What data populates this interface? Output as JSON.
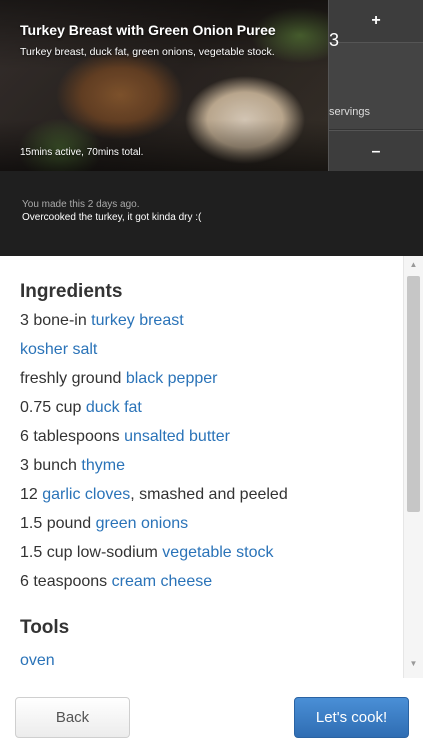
{
  "recipe": {
    "title": "Turkey Breast with Green Onion Puree",
    "subtitle": "Turkey breast, duck fat, green onions, vegetable stock.",
    "time": "15mins active, 70mins total."
  },
  "servings": {
    "plus": "+",
    "count": "3",
    "label": "servings",
    "minus": "–"
  },
  "history": {
    "made_when": "You made this 2 days ago.",
    "note": "Overcooked the turkey, it got kinda dry :("
  },
  "ingredients": {
    "heading": "Ingredients",
    "items": [
      {
        "prefix": "3 bone-in ",
        "link": "turkey breast",
        "suffix": ""
      },
      {
        "prefix": "",
        "link": "kosher salt",
        "suffix": ""
      },
      {
        "prefix": "freshly ground ",
        "link": "black pepper",
        "suffix": ""
      },
      {
        "prefix": "0.75 cup ",
        "link": "duck fat",
        "suffix": ""
      },
      {
        "prefix": "6 tablespoons ",
        "link": "unsalted butter",
        "suffix": ""
      },
      {
        "prefix": "3 bunch ",
        "link": "thyme",
        "suffix": ""
      },
      {
        "prefix": "12 ",
        "link": "garlic cloves",
        "suffix": ", smashed and peeled"
      },
      {
        "prefix": "1.5 pound ",
        "link": "green onions",
        "suffix": ""
      },
      {
        "prefix": "1.5 cup low-sodium ",
        "link": "vegetable stock",
        "suffix": ""
      },
      {
        "prefix": "6 teaspoons ",
        "link": "cream cheese",
        "suffix": ""
      }
    ]
  },
  "tools": {
    "heading": "Tools",
    "items": [
      "oven"
    ]
  },
  "scrollbar": {
    "up_icon": "▲",
    "down_icon": "▼"
  },
  "footer": {
    "back_label": "Back",
    "cook_label": "Let's cook!"
  },
  "colors": {
    "link": "#2a73b8",
    "primary_button": "#3a7fc9",
    "dark_panel": "#1f1f1f"
  }
}
